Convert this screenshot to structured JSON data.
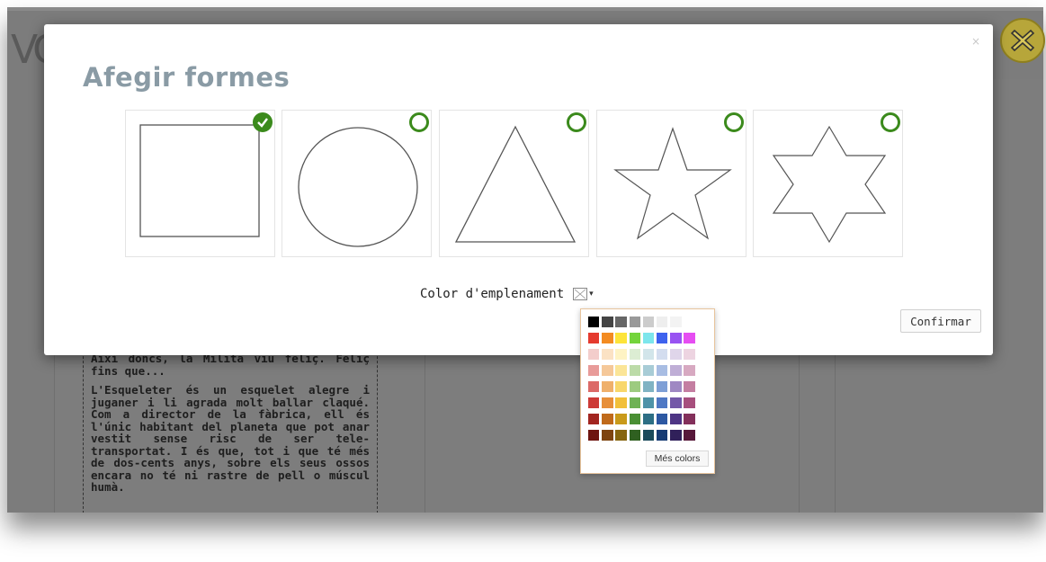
{
  "background": {
    "logo_fragment": "VC",
    "story_paragraphs": [
      "Així doncs, la Milita viu feliç. Feliç fins que...",
      "L'Esqueleter és un esquelet alegre i juganer i li agrada molt ballar claqué. Com a director de la fàbrica, ell és l'únic habitant del planeta que pot anar vestit sense risc de ser tele-transportat. I és que, tot i que té més de dos-cents anys, sobre els seus ossos encara no té ni rastre de pell o múscul humà."
    ],
    "close_icon": "close-x-icon"
  },
  "modal": {
    "close_glyph": "×",
    "title": "Afegir formes",
    "shapes": [
      {
        "name": "square",
        "selected": true
      },
      {
        "name": "circle",
        "selected": false
      },
      {
        "name": "triangle",
        "selected": false
      },
      {
        "name": "five-point-star",
        "selected": false
      },
      {
        "name": "six-point-star",
        "selected": false
      }
    ],
    "fill_label": "Color d'emplenament",
    "fill_caret": "▾",
    "confirm_label": "Confirmar"
  },
  "palette": {
    "rows": [
      [
        "#000000",
        "#444444",
        "#666666",
        "#999999",
        "#cccccc",
        "#eeeeee",
        "#f3f3f3",
        "#ffffff"
      ],
      [
        "#e53a2f",
        "#f38b22",
        "#fde43a",
        "#74d43c",
        "#7de6ec",
        "#3e62ee",
        "#9853f2",
        "#e64df2"
      ],
      [
        "#f3cdcb",
        "#fbe2c4",
        "#fef3c4",
        "#dcedd3",
        "#d2e5ea",
        "#d3ddef",
        "#dfd5ea",
        "#edd4e1"
      ],
      [
        "#e89b99",
        "#f5c899",
        "#fbe597",
        "#bcdba8",
        "#a8ccd6",
        "#a8bde3",
        "#bfaed6",
        "#d7a9c1"
      ],
      [
        "#dc6a68",
        "#ef b06b",
        "#f8d76b",
        "#9dcb80",
        "#80b3c3",
        "#7e9fd6",
        "#9f88c3",
        "#c47ea1"
      ],
      [
        "#cd3a36",
        "#e78f3a",
        "#f2c03a",
        "#6fb255",
        "#4e93a8",
        "#4f78c4",
        "#7458a8",
        "#a74f7d"
      ],
      [
        "#a22520",
        "#c06a1a",
        "#c99a1a",
        "#4a8f34",
        "#2d6f85",
        "#2d58a2",
        "#4e3585",
        "#83305b"
      ],
      [
        "#6e1510",
        "#7e4410",
        "#86650f",
        "#2f6020",
        "#1a4a5a",
        "#173c74",
        "#30205a",
        "#57183a"
      ]
    ],
    "more_label": "Més colors"
  }
}
